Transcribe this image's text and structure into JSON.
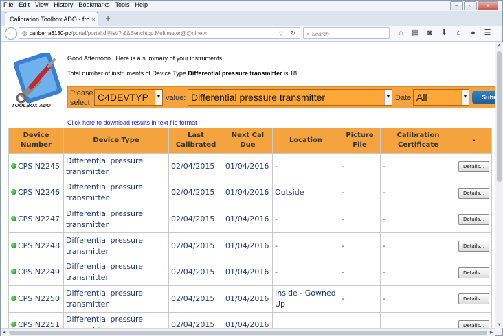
{
  "menu": [
    "File",
    "Edit",
    "View",
    "History",
    "Bookmarks",
    "Tools",
    "Help"
  ],
  "tab": {
    "title": "Calibration Toolbox ADO - fro...",
    "close": "×",
    "new": "+"
  },
  "url": {
    "host": "canberra6130-pc",
    "path": "/portal/portal.dll/listf? &&Benchtop Multimeter@@ninety"
  },
  "search": {
    "placeholder": "Search"
  },
  "logo_text": "TOOLBOX ADO",
  "greeting": "Good Afternoon . Here is a summary of your instruments:",
  "total": {
    "prefix": "Total number of instruments of Device Type ",
    "type": "Differential pressure transmitter",
    "suffix": " is 18"
  },
  "filter": {
    "please_select": "Please select",
    "field_value": "C4DEVTYP",
    "value_label": "value:",
    "value": "Differential pressure transmitter",
    "date_label": "Date",
    "date_value": "All",
    "submit_label": "Subm"
  },
  "download_link": "Click here to download results in text file format",
  "table": {
    "headers": [
      "Device Number",
      "Device Type",
      "Last Calibrated",
      "Next Cal Due",
      "Location",
      "Picture File",
      "Calibration Certificate",
      "-"
    ],
    "details_label": "Details...",
    "rows": [
      {
        "device": "CPS N2245",
        "type": "Differential pressure transmitter",
        "last": "02/04/2015",
        "next": "01/04/2016",
        "location": "-",
        "picture": "-",
        "cert": "-",
        "status_color": "#12a012"
      },
      {
        "device": "CPS N2246",
        "type": "Differential pressure transmitter",
        "last": "02/04/2015",
        "next": "01/04/2016",
        "location": "Outside",
        "picture": "-",
        "cert": "-",
        "status_color": "#12a012"
      },
      {
        "device": "CPS N2247",
        "type": "Differential pressure transmitter",
        "last": "02/04/2015",
        "next": "01/04/2016",
        "location": "-",
        "picture": "-",
        "cert": "-",
        "status_color": "#12a012"
      },
      {
        "device": "CPS N2248",
        "type": "Differential pressure transmitter",
        "last": "02/04/2015",
        "next": "01/04/2016",
        "location": "-",
        "picture": "-",
        "cert": "-",
        "status_color": "#12a012"
      },
      {
        "device": "CPS N2249",
        "type": "Differential pressure transmitter",
        "last": "02/04/2015",
        "next": "01/04/2016",
        "location": "-",
        "picture": "-",
        "cert": "-",
        "status_color": "#12a012"
      },
      {
        "device": "CPS N2250",
        "type": "Differential pressure transmitter",
        "last": "02/04/2015",
        "next": "01/04/2016",
        "location": "Inside - Gowned Up",
        "picture": "-",
        "cert": "-",
        "status_color": "#12a012"
      },
      {
        "device": "CPS N2251",
        "type": "Differential pressure transmitter",
        "last": "02/04/2015",
        "next": "01/04/2016",
        "location": "",
        "picture": "",
        "cert": "",
        "status_color": "#12a012"
      }
    ]
  },
  "colors": {
    "header_orange": "#f5a33f",
    "link_blue": "#1a1adb",
    "cell_text": "#1d3a78"
  }
}
